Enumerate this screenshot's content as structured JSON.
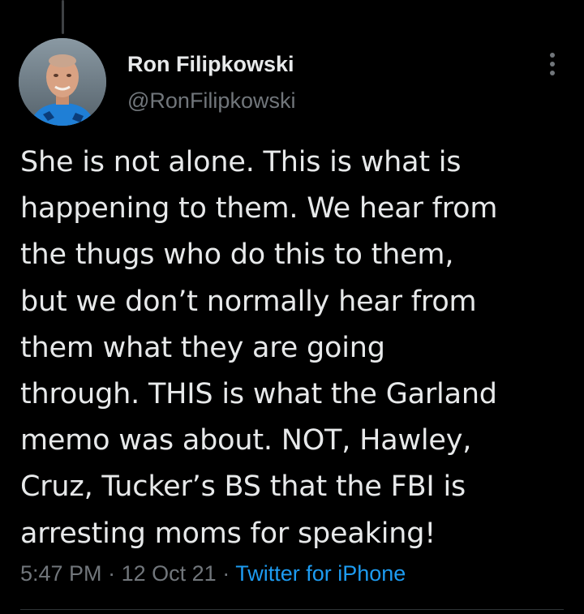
{
  "tweet": {
    "author": {
      "display_name": "Ron Filipkowski",
      "handle": "@RonFilipkowski"
    },
    "text_lines": [
      "She is not alone. This is what is",
      "happening to them. We hear from",
      "the thugs who do this to them,",
      "but we don’t normally hear from",
      "them what they are going",
      "through. THIS is what the Garland",
      "memo was about. NOT, Hawley,",
      "Cruz, Tucker’s BS that the FBI is",
      "arresting moms for speaking!"
    ],
    "meta": {
      "time": "5:47 PM",
      "separator": "·",
      "date": "12 Oct 21",
      "source": "Twitter for iPhone"
    }
  },
  "icons": {
    "more": "more-vertical-icon"
  },
  "colors": {
    "background": "#000000",
    "text": "#e7e9ea",
    "secondary": "#71767b",
    "link": "#1d9bf0"
  }
}
